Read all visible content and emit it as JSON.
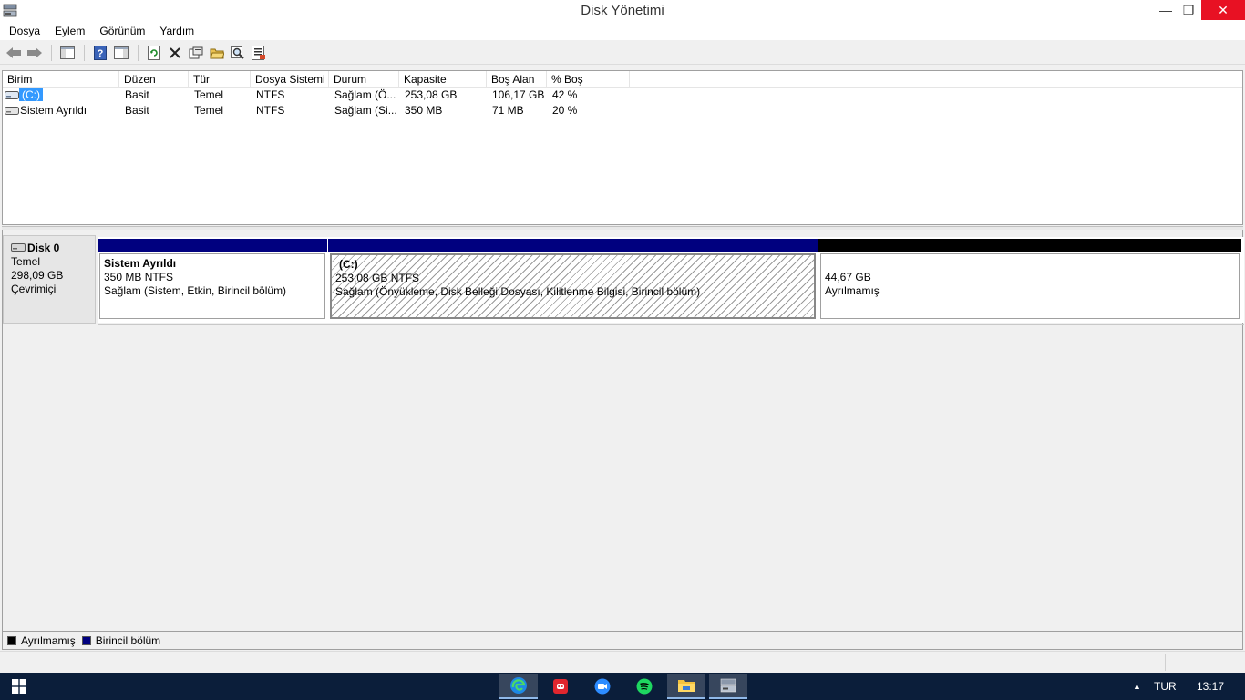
{
  "window": {
    "title": "Disk Yönetimi",
    "minimize_glyph": "—",
    "maximize_glyph": "❐",
    "close_glyph": "✕"
  },
  "menu": [
    "Dosya",
    "Eylem",
    "Görünüm",
    "Yardım"
  ],
  "toolbar": {
    "icons": [
      "back-arrow-icon",
      "forward-arrow-icon",
      "show-hide-console-tree-icon",
      "help-icon",
      "show-action-pane-icon",
      "refresh-icon",
      "delete-icon",
      "properties-icon",
      "open-folder-icon",
      "search-icon",
      "export-list-icon"
    ]
  },
  "volume_list": {
    "columns": [
      "Birim",
      "Düzen",
      "Tür",
      "Dosya Sistemi",
      "Durum",
      "Kapasite",
      "Boş Alan",
      "% Boş"
    ],
    "rows": [
      {
        "name": "(C:)",
        "layout": "Basit",
        "type": "Temel",
        "fs": "NTFS",
        "status": "Sağlam (Ö...",
        "capacity": "253,08 GB",
        "free": "106,17 GB",
        "pct": "42 %",
        "selected": true
      },
      {
        "name": "Sistem Ayrıldı",
        "layout": "Basit",
        "type": "Temel",
        "fs": "NTFS",
        "status": "Sağlam (Si...",
        "capacity": "350 MB",
        "free": "71 MB",
        "pct": "20 %",
        "selected": false
      }
    ]
  },
  "disk": {
    "name": "Disk 0",
    "kind": "Temel",
    "size": "298,09 GB",
    "state": "Çevrimiçi",
    "partitions": [
      {
        "title": "Sistem Ayrıldı",
        "size": "350 MB NTFS",
        "status": "Sağlam (Sistem, Etkin, Birincil bölüm)",
        "bar_color": "#00007f",
        "hatched": false
      },
      {
        "title": "(C:)",
        "size": "253,08 GB NTFS",
        "status": "Sağlam (Önyükleme, Disk Belleği Dosyası, Kilitlenme Bilgisi, Birincil bölüm)",
        "bar_color": "#00007f",
        "hatched": true
      },
      {
        "title": "",
        "size": "44,67 GB",
        "status": "Ayrılmamış",
        "bar_color": "#000000",
        "hatched": false
      }
    ]
  },
  "legend": [
    {
      "label": "Ayrılmamış",
      "color": "#000000"
    },
    {
      "label": "Birincil bölüm",
      "color": "#00007f"
    }
  ],
  "taskbar": {
    "apps": [
      "edge-icon",
      "discord-icon",
      "zoom-icon",
      "spotify-icon",
      "file-explorer-icon",
      "disk-management-icon"
    ],
    "language": "TUR",
    "clock": "13:17",
    "tray_chevron": "▲"
  }
}
